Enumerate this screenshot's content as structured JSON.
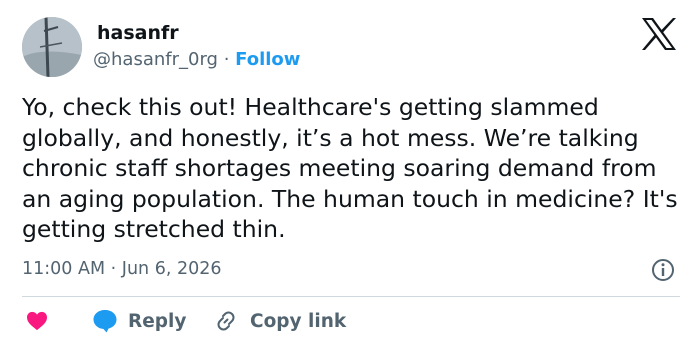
{
  "author": {
    "name": "hasanfr",
    "handle": "@hasanfr_0rg",
    "separator": "·",
    "follow_label": "Follow"
  },
  "tweet": {
    "text": "Yo, check this out! Healthcare's getting slammed globally, and honestly, it’s a hot mess. We’re talking chronic staff shortages meeting soaring demand from an aging population. The human touch in medicine? It's getting stretched thin.",
    "time": "11:00 AM",
    "separator": "·",
    "date": "Jun 6, 2026"
  },
  "actions": {
    "reply_label": "Reply",
    "copy_link_label": "Copy link"
  },
  "colors": {
    "text": "#0f1419",
    "secondary": "#536471",
    "accent": "#1d9bf0",
    "like": "#f91880",
    "divider": "#cfd9de"
  },
  "icons": [
    "avatar-photo",
    "x-logo-icon",
    "info-icon",
    "heart-icon",
    "reply-bubble-icon",
    "link-icon"
  ]
}
